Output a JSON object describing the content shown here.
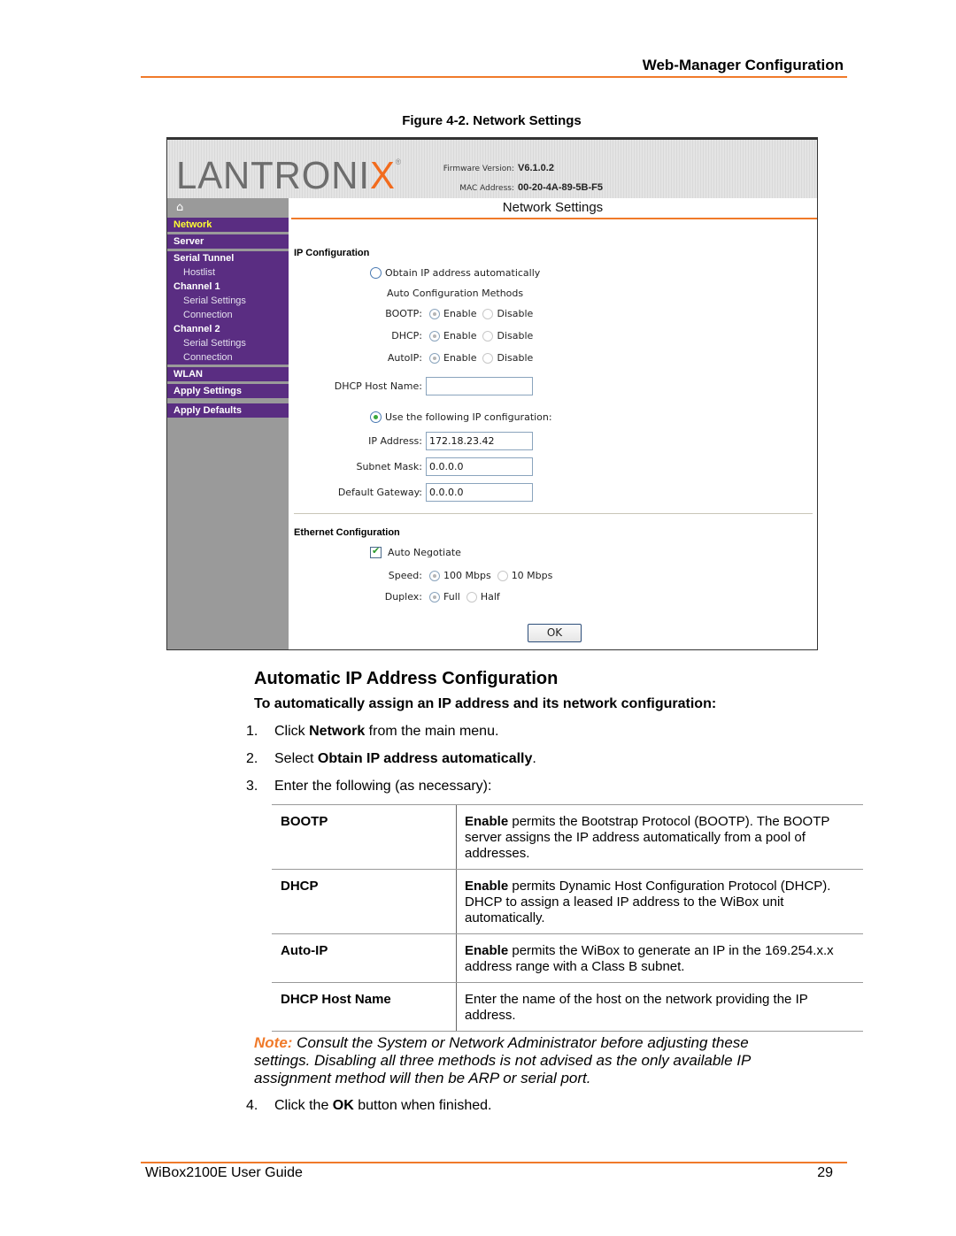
{
  "page_header": {
    "title": "Web-Manager Configuration"
  },
  "figure_caption": "Figure 4-2. Network Settings",
  "screenshot": {
    "logo": {
      "text_main": "LANTRONI",
      "text_accent": "X",
      "registered": "®"
    },
    "firmware": {
      "label": "Firmware Version:",
      "value": "V6.1.0.2"
    },
    "mac": {
      "label": "MAC Address:",
      "value": "00-20-4A-89-5B-F5"
    },
    "home_icon": "⌂",
    "sidebar": {
      "items": [
        {
          "label": "Network",
          "type": "main",
          "active": true
        },
        {
          "label": "Server",
          "type": "main"
        },
        {
          "label": "Serial Tunnel",
          "type": "main"
        },
        {
          "label": "Hostlist",
          "type": "sub"
        },
        {
          "label": "Channel 1",
          "type": "main"
        },
        {
          "label": "Serial Settings",
          "type": "sub"
        },
        {
          "label": "Connection",
          "type": "sub"
        },
        {
          "label": "Channel 2",
          "type": "main"
        },
        {
          "label": "Serial Settings",
          "type": "sub"
        },
        {
          "label": "Connection",
          "type": "sub"
        },
        {
          "label": "WLAN",
          "type": "main"
        },
        {
          "label": "Apply Settings",
          "type": "main"
        },
        {
          "label": "Apply Defaults",
          "type": "main"
        }
      ]
    },
    "page_title": "Network Settings",
    "ip_config": {
      "section_title": "IP Configuration",
      "obtain_auto_label": "Obtain IP address automatically",
      "obtain_auto_selected": false,
      "methods_label": "Auto Configuration Methods",
      "bootp": {
        "label": "BOOTP:",
        "enable": "Enable",
        "disable": "Disable",
        "value": "Enable"
      },
      "dhcp": {
        "label": "DHCP:",
        "enable": "Enable",
        "disable": "Disable",
        "value": "Enable"
      },
      "autoip": {
        "label": "AutoIP:",
        "enable": "Enable",
        "disable": "Disable",
        "value": "Enable"
      },
      "dhcp_host_name": {
        "label": "DHCP Host Name:",
        "value": ""
      },
      "use_following_label": "Use the following IP configuration:",
      "use_following_selected": true,
      "ip_address": {
        "label": "IP Address:",
        "value": "172.18.23.42"
      },
      "subnet_mask": {
        "label": "Subnet Mask:",
        "value": "0.0.0.0"
      },
      "default_gateway": {
        "label": "Default Gateway:",
        "value": "0.0.0.0"
      }
    },
    "ethernet_config": {
      "section_title": "Ethernet Configuration",
      "auto_negotiate": {
        "label": "Auto Negotiate",
        "checked": true
      },
      "speed": {
        "label": "Speed:",
        "opt1": "100 Mbps",
        "opt2": "10 Mbps",
        "value": "100 Mbps"
      },
      "duplex": {
        "label": "Duplex:",
        "opt1": "Full",
        "opt2": "Half",
        "value": "Full"
      }
    },
    "ok_button": "OK"
  },
  "doc": {
    "heading": "Automatic IP Address Configuration",
    "subheading": "To automatically assign an IP address and its network configuration:",
    "steps": [
      {
        "num": "1.",
        "pre": "Click ",
        "bold": "Network",
        "post": " from the main menu."
      },
      {
        "num": "2.",
        "pre": "Select ",
        "bold": "Obtain IP address automatically",
        "post": "."
      },
      {
        "num": "3.",
        "pre": "Enter the following (as necessary):",
        "bold": "",
        "post": ""
      },
      {
        "num": "4.",
        "pre": "Click the ",
        "bold": "OK",
        "post": " button when finished."
      }
    ],
    "table": [
      {
        "term": "BOOTP",
        "bold": "Enable",
        "desc": " permits the Bootstrap Protocol (BOOTP). The BOOTP server assigns the IP address automatically from a pool of addresses."
      },
      {
        "term": "DHCP",
        "bold": "Enable",
        "desc": " permits Dynamic Host Configuration Protocol (DHCP). DHCP to assign a leased IP address to the WiBox unit automatically."
      },
      {
        "term": "Auto-IP",
        "bold": "Enable",
        "desc": " permits the WiBox to generate an IP in the 169.254.x.x address range with a Class B subnet."
      },
      {
        "term": "DHCP Host Name",
        "bold": "",
        "desc": "Enter the name of the host on the network providing the IP address."
      }
    ],
    "note": {
      "label": "Note:",
      "text": " Consult the System or Network Administrator before adjusting these settings. Disabling all three methods is not advised as the only available IP assignment method will then be ARP or serial port."
    }
  },
  "footer": {
    "left": "WiBox2100E User Guide",
    "page_number": "29"
  },
  "colors": {
    "accent_orange": "#f07a2a",
    "sidebar_purple": "#5a2d82",
    "active_nav": "#ffff33"
  }
}
